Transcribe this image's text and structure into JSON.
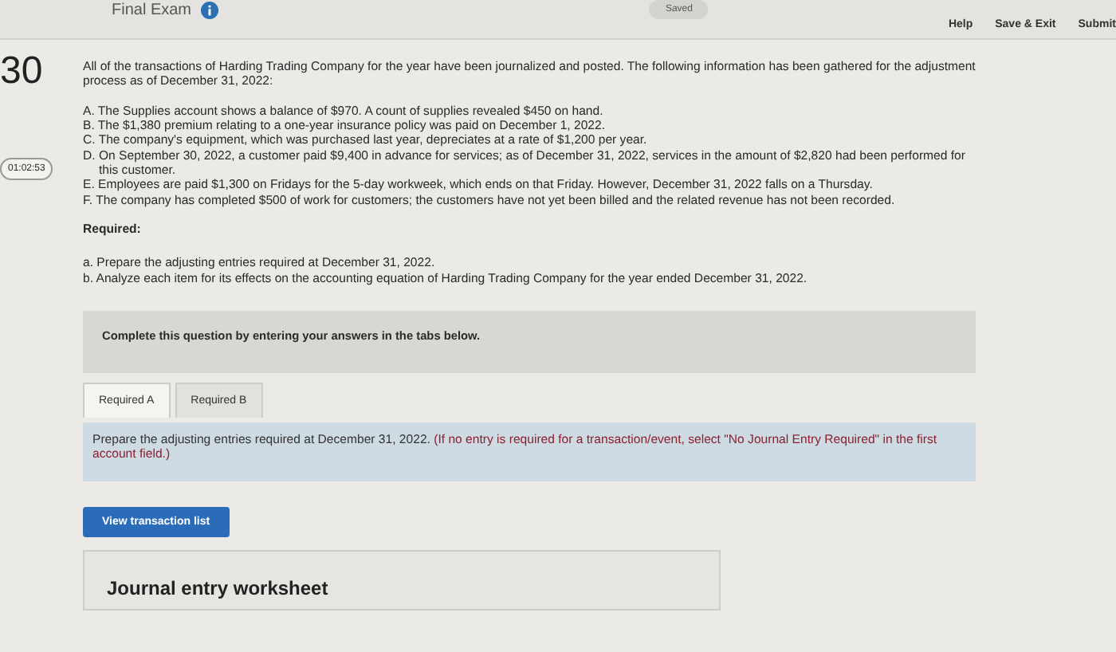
{
  "header": {
    "title": "Final Exam",
    "status": "Saved",
    "links": [
      "Help",
      "Save & Exit",
      "Submit"
    ]
  },
  "question_number": "30",
  "timer": "01:02:53",
  "intro": "All of the transactions of Harding Trading Company for the year have been journalized and posted. The following information has been gathered for the adjustment process as of December 31, 2022:",
  "items": [
    {
      "text": "A. The Supplies account shows a balance of $970. A count of supplies revealed $450 on hand."
    },
    {
      "text": "B. The $1,380 premium relating to a one-year insurance policy was paid on December 1, 2022."
    },
    {
      "text": "C. The company's equipment, which was purchased last year, depreciates at a rate of $1,200 per year."
    },
    {
      "text": "D. On September 30, 2022, a customer paid $9,400 in advance for services; as of December 31, 2022, services in the amount of $2,820 had been performed for this customer."
    },
    {
      "text": "E. Employees are paid $1,300 on Fridays for the 5-day workweek, which ends on that Friday. However, December 31, 2022 falls on a Thursday."
    },
    {
      "text": "F. The company has completed $500 of work for customers; the customers have not yet been billed and the related revenue has not been recorded."
    }
  ],
  "required_heading": "Required:",
  "required_items": [
    "a. Prepare the adjusting entries required at December 31, 2022.",
    "b. Analyze each item for its effects on the accounting equation of Harding Trading Company for the year ended December 31, 2022."
  ],
  "banner": "Complete this question by entering your answers in the tabs below.",
  "tabs": [
    {
      "label": "Required A",
      "selected": true
    },
    {
      "label": "Required B",
      "selected": false
    }
  ],
  "instruction": "Prepare the adjusting entries required at December 31, 2022.",
  "instruction_note": "(If no entry is required for a transaction/event, select \"No Journal Entry Required\" in the first account field.)",
  "view_button": "View transaction list",
  "worksheet_title": "Journal entry worksheet"
}
